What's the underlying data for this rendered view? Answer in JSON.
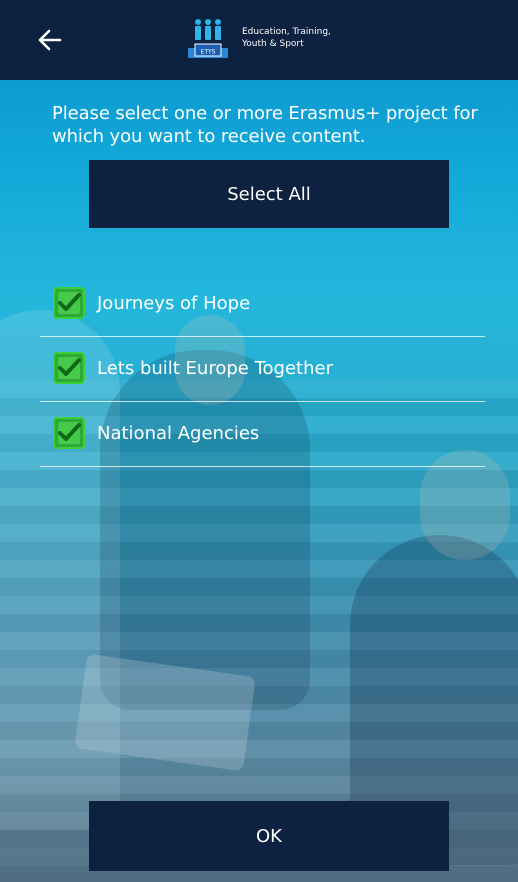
{
  "header": {
    "back_icon": "arrow-left-icon",
    "logo_badge_text": "ETYS",
    "logo_line1": "Education, Training,",
    "logo_line2": "Youth & Sport"
  },
  "prompt": {
    "text": "Please select one or more Erasmus+ project for which you want to receive content."
  },
  "select_all": {
    "label": "Select All"
  },
  "projects": [
    {
      "label": "Journeys of Hope",
      "checked": true
    },
    {
      "label": "Lets built Europe Together",
      "checked": true
    },
    {
      "label": "National Agencies",
      "checked": true
    }
  ],
  "footer": {
    "ok_label": "OK"
  },
  "colors": {
    "bar": "#0d2140",
    "check_green": "#3bd13b",
    "text": "#ffffff"
  }
}
